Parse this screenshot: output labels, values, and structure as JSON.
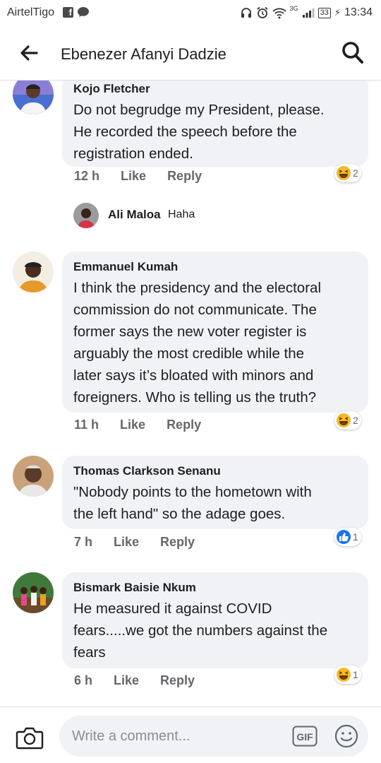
{
  "status_bar": {
    "carrier": "AirtelTigo",
    "network": "3G",
    "battery": "33",
    "time": "13:34"
  },
  "header": {
    "title": "Ebenezer Afanyi Dadzie"
  },
  "comments": [
    {
      "name": "Kojo Fletcher",
      "text": [
        "Do not begrudge my President, please.",
        "He recorded the speech before the",
        "registration ended."
      ],
      "time": "12 h",
      "like_label": "Like",
      "reply_label": "Reply",
      "reaction": "haha",
      "reaction_count": "2",
      "reply": {
        "name": "Ali Maloa",
        "text": "Haha"
      }
    },
    {
      "name": "Emmanuel Kumah",
      "text": [
        "I think the presidency and the electoral",
        "commission do not communicate. The",
        "former says the new voter register is",
        "arguably the most credible while the",
        "later says it’s bloated with minors and",
        "foreigners. Who is telling us the truth?"
      ],
      "time": "11 h",
      "like_label": "Like",
      "reply_label": "Reply",
      "reaction": "haha",
      "reaction_count": "2"
    },
    {
      "name": "Thomas Clarkson Senanu",
      "text": [
        "\"Nobody points to the hometown with",
        "the left hand\" so the adage goes."
      ],
      "time": "7 h",
      "like_label": "Like",
      "reply_label": "Reply",
      "reaction": "like",
      "reaction_count": "1"
    },
    {
      "name": "Bismark Baisie Nkum",
      "text": [
        "He measured it against COVID",
        "fears.....we got the numbers against the",
        "fears"
      ],
      "time": "6 h",
      "like_label": "Like",
      "reply_label": "Reply",
      "reaction": "haha",
      "reaction_count": "1"
    }
  ],
  "composer": {
    "placeholder": "Write a comment...",
    "gif_label": "GIF"
  },
  "colors": {
    "bubble": "#f0f2f5",
    "meta_text": "#65676b",
    "like_blue": "#1877f2",
    "haha_yellow": "#f7b928"
  },
  "icons": {
    "back": "arrow-left-icon",
    "search": "search-icon",
    "camera": "camera-icon",
    "gif": "gif-icon",
    "emoji": "smiley-icon"
  }
}
